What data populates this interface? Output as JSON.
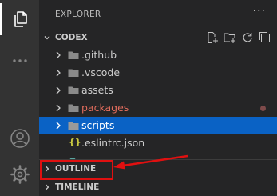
{
  "activity_bar": {
    "items": [
      {
        "icon": "explorer-icon",
        "active": true
      },
      {
        "icon": "more-icon",
        "active": false
      },
      {
        "icon": "accounts-icon",
        "active": false
      },
      {
        "icon": "settings-gear-icon",
        "active": false
      }
    ]
  },
  "explorer": {
    "title": "EXPLORER",
    "more_label": "···",
    "workspace": {
      "name": "CODEX",
      "actions": [
        "new-file-icon",
        "new-folder-icon",
        "refresh-icon",
        "collapse-all-icon"
      ]
    },
    "tree": [
      {
        "name": ".github",
        "type": "folder",
        "color": "#cccccc"
      },
      {
        "name": ".vscode",
        "type": "folder",
        "color": "#cccccc"
      },
      {
        "name": "assets",
        "type": "folder",
        "color": "#cccccc"
      },
      {
        "name": "packages",
        "type": "folder",
        "color": "#e06c5c",
        "modified": true
      },
      {
        "name": "scripts",
        "type": "folder",
        "color": "#ffffff",
        "selected": true
      },
      {
        "name": ".eslintrc.json",
        "type": "json-file",
        "color": "#cccccc",
        "icon_glyph": "{}"
      }
    ],
    "sections": [
      {
        "name": "OUTLINE"
      },
      {
        "name": "TIMELINE"
      }
    ]
  },
  "colors": {
    "selection": "#0a62c5",
    "annotation": "#e01010",
    "modified": "#e06c5c"
  }
}
